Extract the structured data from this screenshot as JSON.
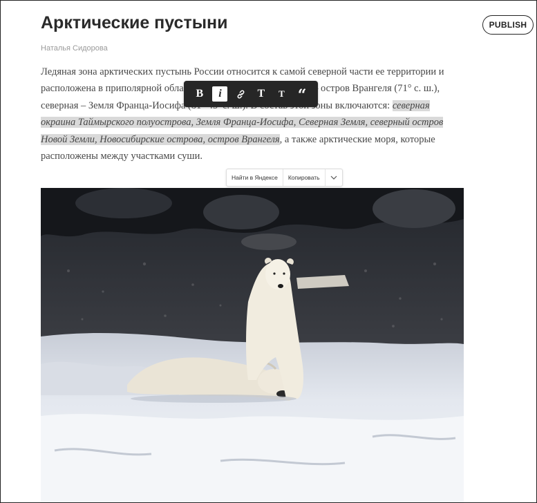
{
  "header": {
    "publish_label": "PUBLISH"
  },
  "article": {
    "title": "Арктические пустыни",
    "author": "Наталья Сидорова",
    "text_before": "Ледяная зона арктических пустынь России относится к самой северной части ее территории и расположена в приполярной области Арктики. Южная граница – остров Врангеля (71° с. ш.), северная – Земля Франца-Иосифа (81° 45′ с. ш.). В состав этой зоны включаются: ",
    "text_selected": "северная окраина Таймырского полуострова, Земля Франца-Иосифа, Северная Земля, северный остров Новой Земли, Новосибирские острова, остров Врангеля",
    "text_after": ", а также арктические моря, которые расположены между участками суши."
  },
  "format_toolbar": {
    "bold": "B",
    "italic": "i",
    "heading_large": "T",
    "heading_small": "T",
    "quote": "“"
  },
  "context_menu": {
    "search": "Найти в Яндексе",
    "copy": "Копировать"
  }
}
